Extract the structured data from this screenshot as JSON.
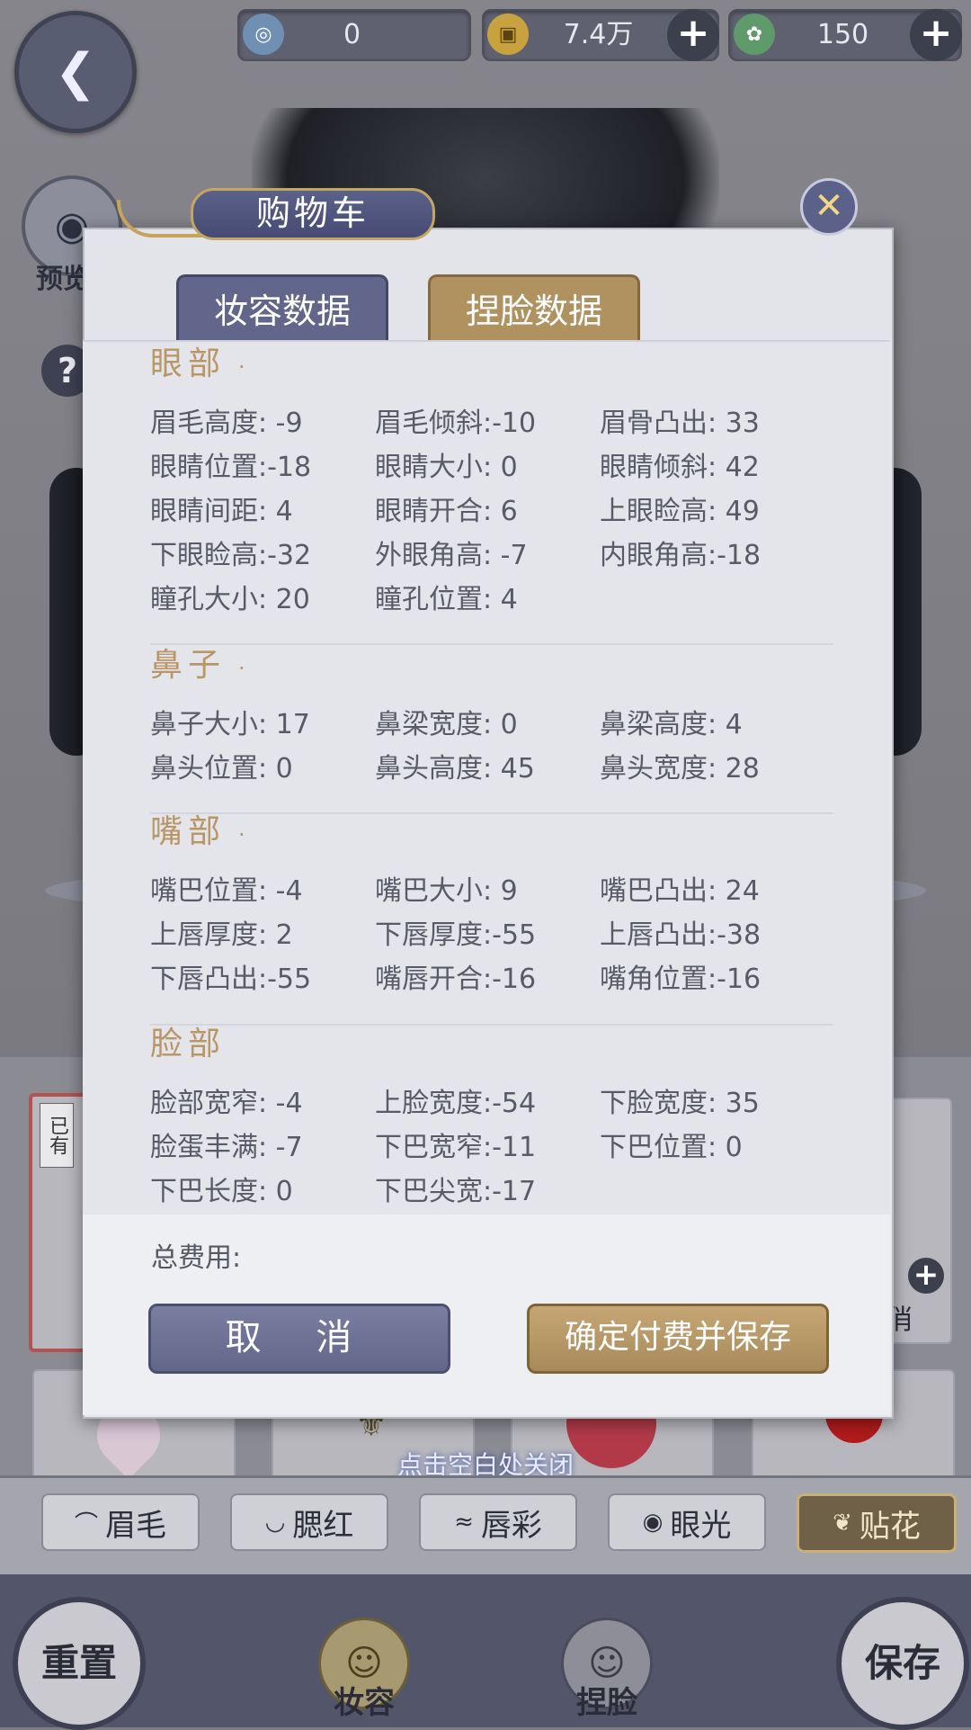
{
  "currency": {
    "jade": "0",
    "coins": "7.4万",
    "stamina": "150"
  },
  "side": {
    "preview_label": "预览"
  },
  "dialog": {
    "title": "购物车",
    "tabs": [
      "妆容数据",
      "捏脸数据"
    ],
    "active_tab": "捏脸数据",
    "sections": [
      {
        "title": "眼部",
        "items": [
          "眉毛高度: -9",
          "眉毛倾斜:-10",
          "眉骨凸出: 33",
          "眼睛位置:-18",
          "眼睛大小: 0",
          "眼睛倾斜: 42",
          "眼睛间距: 4",
          "眼睛开合: 6",
          "上眼睑高: 49",
          "下眼睑高:-32",
          "外眼角高: -7",
          "内眼角高:-18",
          "瞳孔大小: 20",
          "瞳孔位置: 4"
        ]
      },
      {
        "title": "鼻子",
        "items": [
          "鼻子大小: 17",
          "鼻梁宽度: 0",
          "鼻梁高度: 4",
          "鼻头位置: 0",
          "鼻头高度: 45",
          "鼻头宽度: 28"
        ]
      },
      {
        "title": "嘴部",
        "items": [
          "嘴巴位置: -4",
          "嘴巴大小: 9",
          "嘴巴凸出: 24",
          "上唇厚度: 2",
          "下唇厚度:-55",
          "上唇凸出:-38",
          "下唇凸出:-55",
          "嘴唇开合:-16",
          "嘴角位置:-16"
        ]
      },
      {
        "title": "脸部",
        "items": [
          "脸部宽窄: -4",
          "上脸宽度:-54",
          "下脸宽度: 35",
          "脸蛋丰满: -7",
          "下巴宽窄:-11",
          "下巴位置: 0",
          "下巴长度: 0",
          "下巴尖宽:-17"
        ]
      }
    ],
    "total_label": "总费用:",
    "cancel_label": "取 消",
    "confirm_label": "确定付费并保存"
  },
  "close_hint": "点击空白处关闭",
  "card_labels": {
    "owned": "已有",
    "right_label": "俏"
  },
  "categories": [
    "眉毛",
    "腮红",
    "唇彩",
    "眼光",
    "贴花"
  ],
  "active_category": "贴花",
  "nav": {
    "reset": "重置",
    "makeup": "妆容",
    "face": "捏脸",
    "save": "保存"
  },
  "colors": {
    "section_title": "#b99666",
    "tab_makeup": "#62668a",
    "tab_face": "#b09260",
    "confirm": "#b8996a"
  }
}
